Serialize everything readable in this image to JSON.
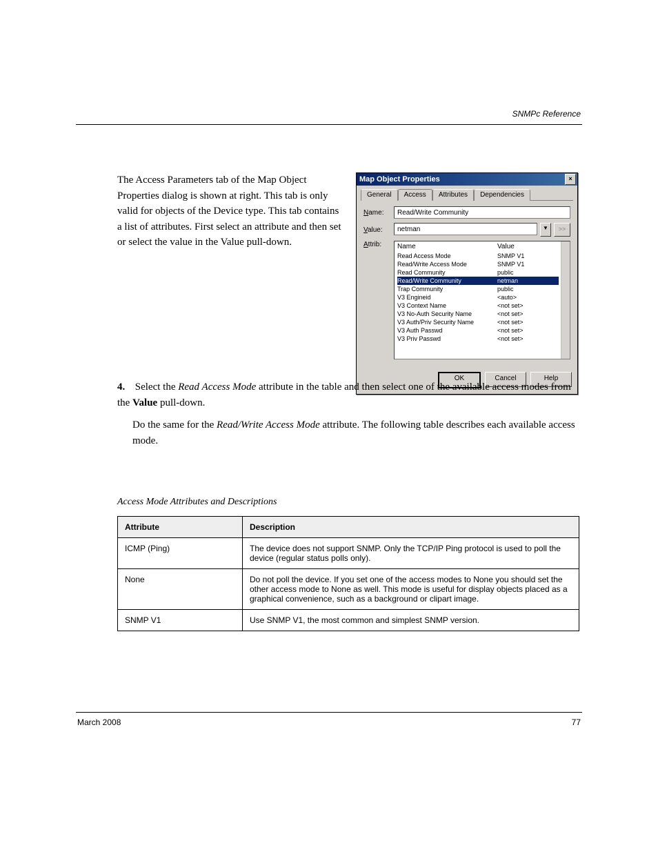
{
  "header": {
    "section_title": "SNMPc Reference"
  },
  "intro": {
    "text": "The Access Parameters tab of the Map Object Properties dialog is shown at right. This tab is only valid for objects of the Device type. This tab contains a list of attributes. First select an attribute and then set or select the value in the Value pull-down."
  },
  "dialog": {
    "title": "Map Object Properties",
    "tabs": [
      "General",
      "Access",
      "Attributes",
      "Dependencies"
    ],
    "active_tab": "Access",
    "name_label": "Name:",
    "value_label": "Value:",
    "attrib_label": "Attrib:",
    "name_value": "Read/Write Community",
    "value_value": "netman",
    "combo_glyph": "▼",
    "ext_glyph": ">>",
    "list_header": {
      "col1": "Name",
      "col2": "Value"
    },
    "list": [
      {
        "n": "Read Access Mode",
        "v": "SNMP V1",
        "sel": false
      },
      {
        "n": "Read/Write Access Mode",
        "v": "SNMP V1",
        "sel": false
      },
      {
        "n": "Read Community",
        "v": "public",
        "sel": false
      },
      {
        "n": "Read/Write Community",
        "v": "netman",
        "sel": true
      },
      {
        "n": "Trap Community",
        "v": "public",
        "sel": false
      },
      {
        "n": "V3 Engineid",
        "v": "<auto>",
        "sel": false
      },
      {
        "n": "V3 Context Name",
        "v": "<not set>",
        "sel": false
      },
      {
        "n": "V3 No-Auth Security Name",
        "v": "<not set>",
        "sel": false
      },
      {
        "n": "V3 Auth/Priv Security Name",
        "v": "<not set>",
        "sel": false
      },
      {
        "n": "V3 Auth Passwd",
        "v": "<not set>",
        "sel": false
      },
      {
        "n": "V3 Priv Passwd",
        "v": "<not set>",
        "sel": false
      }
    ],
    "buttons": {
      "ok": "OK",
      "cancel": "Cancel",
      "help": "Help"
    }
  },
  "step4": {
    "num": "4.",
    "line1_a": "Select the ",
    "line1_b": "Read Access Mode",
    "line1_c": " attribute in the table and then select one of the available access modes from the ",
    "line1_d": "Value",
    "line1_e": " pull-down.",
    "line2_a": "Do the same for the ",
    "line2_b": "Read/Write Access Mode",
    "line2_c": " attribute. The following table describes each available access mode."
  },
  "table_title": "Access Mode Attributes and Descriptions",
  "table": {
    "head": {
      "attr": "Attribute",
      "desc": "Description"
    },
    "rows": [
      {
        "attr": "ICMP (Ping)",
        "desc": "The device does not support SNMP. Only the TCP/IP Ping protocol is used to poll the device (regular status polls only)."
      },
      {
        "attr": "None",
        "desc": "Do not poll the device. If you set one of the access modes to None you should set the other access mode to None as well. This mode is useful for display objects placed as a graphical convenience, such as a background or clipart image."
      },
      {
        "attr": "SNMP V1",
        "desc": "Use SNMP V1, the most common and simplest SNMP version."
      }
    ]
  },
  "footer": {
    "revision": "March 2008",
    "page": "77"
  }
}
